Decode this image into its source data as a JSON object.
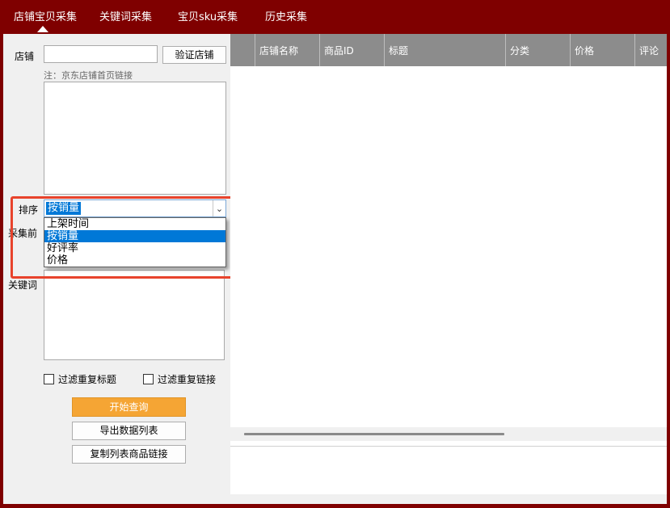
{
  "tabs": [
    {
      "label": "店铺宝贝采集",
      "active": true
    },
    {
      "label": "关键词采集",
      "active": false
    },
    {
      "label": "宝贝sku采集",
      "active": false
    },
    {
      "label": "历史采集",
      "active": false
    }
  ],
  "form": {
    "shop_label": "店铺",
    "shop_value": "",
    "verify_button": "验证店铺",
    "note": "注：京东店铺首页链接",
    "sort_label": "排序",
    "sort_value": "按销量",
    "sort_options": [
      "上架时间",
      "按销量",
      "好评率",
      "价格"
    ],
    "sort_selected_index": 1,
    "pre_collect_label": "采集前",
    "keyword_label": "关键词",
    "filter_title": "过滤重复标题",
    "filter_link": "过滤重复链接",
    "filter_title_checked": false,
    "filter_link_checked": false,
    "start_button": "开始查询",
    "export_button": "导出数据列表",
    "copy_button": "复制列表商品链接"
  },
  "grid": {
    "columns": [
      "",
      "店铺名称",
      "商品ID",
      "标题",
      "分类",
      "价格",
      "评论"
    ],
    "rows": []
  },
  "colors": {
    "frame": "#7f0000",
    "primary_button": "#f5a534",
    "selection": "#0078d7",
    "annotation": "#e8432c"
  }
}
